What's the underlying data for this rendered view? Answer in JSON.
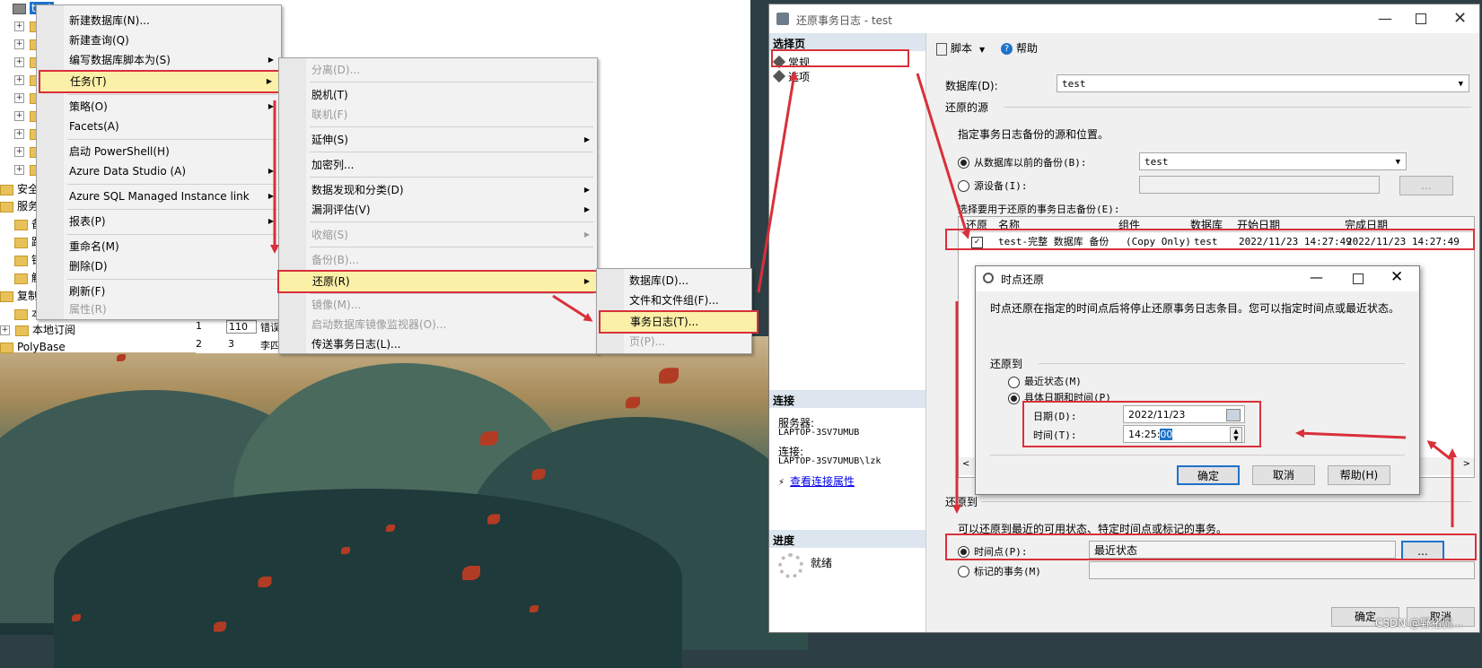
{
  "tree": {
    "root_label": "test",
    "items": [
      "安全",
      "服务器",
      "备",
      "路",
      "锁",
      "触",
      "复制",
      "本",
      "本地订阅",
      "PolyBase"
    ]
  },
  "grid": {
    "rows": [
      [
        "1",
        "110",
        "错误"
      ],
      [
        "2",
        "3",
        "李四"
      ]
    ]
  },
  "context_menu": {
    "items": [
      {
        "label": "新建数据库(N)...",
        "sub": false,
        "disabled": false
      },
      {
        "label": "新建查询(Q)",
        "sub": false,
        "disabled": false
      },
      {
        "label": "编写数据库脚本为(S)",
        "sub": true,
        "disabled": false
      },
      {
        "label": "任务(T)",
        "sub": true,
        "disabled": false,
        "highlight": true
      },
      {
        "label": "策略(O)",
        "sub": true,
        "disabled": false
      },
      {
        "label": "Facets(A)",
        "sub": false,
        "disabled": false
      },
      {
        "label": "启动 PowerShell(H)",
        "sub": false,
        "disabled": false
      },
      {
        "label": "Azure Data Studio (A)",
        "sub": true,
        "disabled": false
      },
      {
        "label": "Azure SQL Managed Instance link",
        "sub": true,
        "disabled": false
      },
      {
        "label": "报表(P)",
        "sub": true,
        "disabled": false
      },
      {
        "label": "重命名(M)",
        "sub": false,
        "disabled": false
      },
      {
        "label": "删除(D)",
        "sub": false,
        "disabled": false
      },
      {
        "label": "刷新(F)",
        "sub": false,
        "disabled": false
      },
      {
        "label": "属性(R)",
        "sub": false,
        "disabled": true
      }
    ]
  },
  "tasks_menu": {
    "items": [
      {
        "label": "分离(D)...",
        "sub": false,
        "disabled": true
      },
      {
        "label": "脱机(T)",
        "sub": false,
        "disabled": false
      },
      {
        "label": "联机(F)",
        "sub": false,
        "disabled": true
      },
      {
        "label": "延伸(S)",
        "sub": true,
        "disabled": false
      },
      {
        "label": "加密列...",
        "sub": false,
        "disabled": false
      },
      {
        "label": "数据发现和分类(D)",
        "sub": true,
        "disabled": false
      },
      {
        "label": "漏洞评估(V)",
        "sub": true,
        "disabled": false
      },
      {
        "label": "收缩(S)",
        "sub": true,
        "disabled": true
      },
      {
        "label": "备份(B)...",
        "sub": false,
        "disabled": true
      },
      {
        "label": "还原(R)",
        "sub": true,
        "disabled": false,
        "highlight": true
      },
      {
        "label": "镜像(M)...",
        "sub": false,
        "disabled": true
      },
      {
        "label": "启动数据库镜像监视器(O)...",
        "sub": false,
        "disabled": true
      },
      {
        "label": "传送事务日志(L)...",
        "sub": false,
        "disabled": false
      }
    ]
  },
  "restore_menu": {
    "items": [
      {
        "label": "数据库(D)...",
        "disabled": false
      },
      {
        "label": "文件和文件组(F)...",
        "disabled": false
      },
      {
        "label": "事务日志(T)...",
        "disabled": false,
        "highlight": true
      },
      {
        "label": "页(P)...",
        "disabled": true
      }
    ]
  },
  "restore_dialog": {
    "title": "还原事务日志 - test",
    "select_page": "选择页",
    "pages": [
      "常规",
      "选项"
    ],
    "toolbar": {
      "script": "脚本",
      "help": "帮助"
    },
    "database_label": "数据库(D):",
    "database_value": "test",
    "source_section": "还原的源",
    "source_hint": "指定事务日志备份的源和位置。",
    "from_backup_label": "从数据库以前的备份(B):",
    "from_backup_value": "test",
    "from_device_label": "源设备(I):",
    "browse_label": "...",
    "select_backups_label": "选择要用于还原的事务日志备份(E):",
    "grid_headers": [
      "还原",
      "名称",
      "组件",
      "数据库",
      "开始日期",
      "完成日期"
    ],
    "grid_row": [
      "test-完整 数据库 备份",
      "(Copy Only)",
      "test",
      "2022/11/23 14:27:49",
      "2022/11/23 14:27:49"
    ],
    "restore_to_section": "还原到",
    "restore_to_hint": "可以还原到最近的可用状态、特定时间点或标记的事务。",
    "point_in_time_label": "时间点(P):",
    "point_in_time_value": "最近状态",
    "marked_tx_label": "标记的事务(M)",
    "connect_section": "连接",
    "server_label": "服务器:",
    "server_value": "LAPTOP-3SV7UMUB",
    "connection_label": "连接:",
    "connection_value": "LAPTOP-3SV7UMUB\\lzk",
    "view_conn_props": "查看连接属性",
    "progress_section": "进度",
    "progress_status": "就绪",
    "ok_label": "确定",
    "cancel_label": "取消"
  },
  "pit_dialog": {
    "title": "时点还原",
    "description": "时点还原在指定的时间点后将停止还原事务日志条目。您可以指定时间点或最近状态。",
    "restore_to": "还原到",
    "latest_label": "最近状态(M)",
    "specific_label": "具体日期和时间(P)",
    "date_label": "日期(D):",
    "date_value": "2022/11/23",
    "time_label": "时间(T):",
    "time_value": "14:25:",
    "time_selected": "00",
    "ok_label": "确定",
    "cancel_label": "取消",
    "help_label": "帮助(H)"
  },
  "watermark": "CSDN @野猪佩...",
  "colors": {
    "highlight": "#fbf0a8",
    "annotation_red": "#d9303a",
    "link": "#0000ee"
  }
}
